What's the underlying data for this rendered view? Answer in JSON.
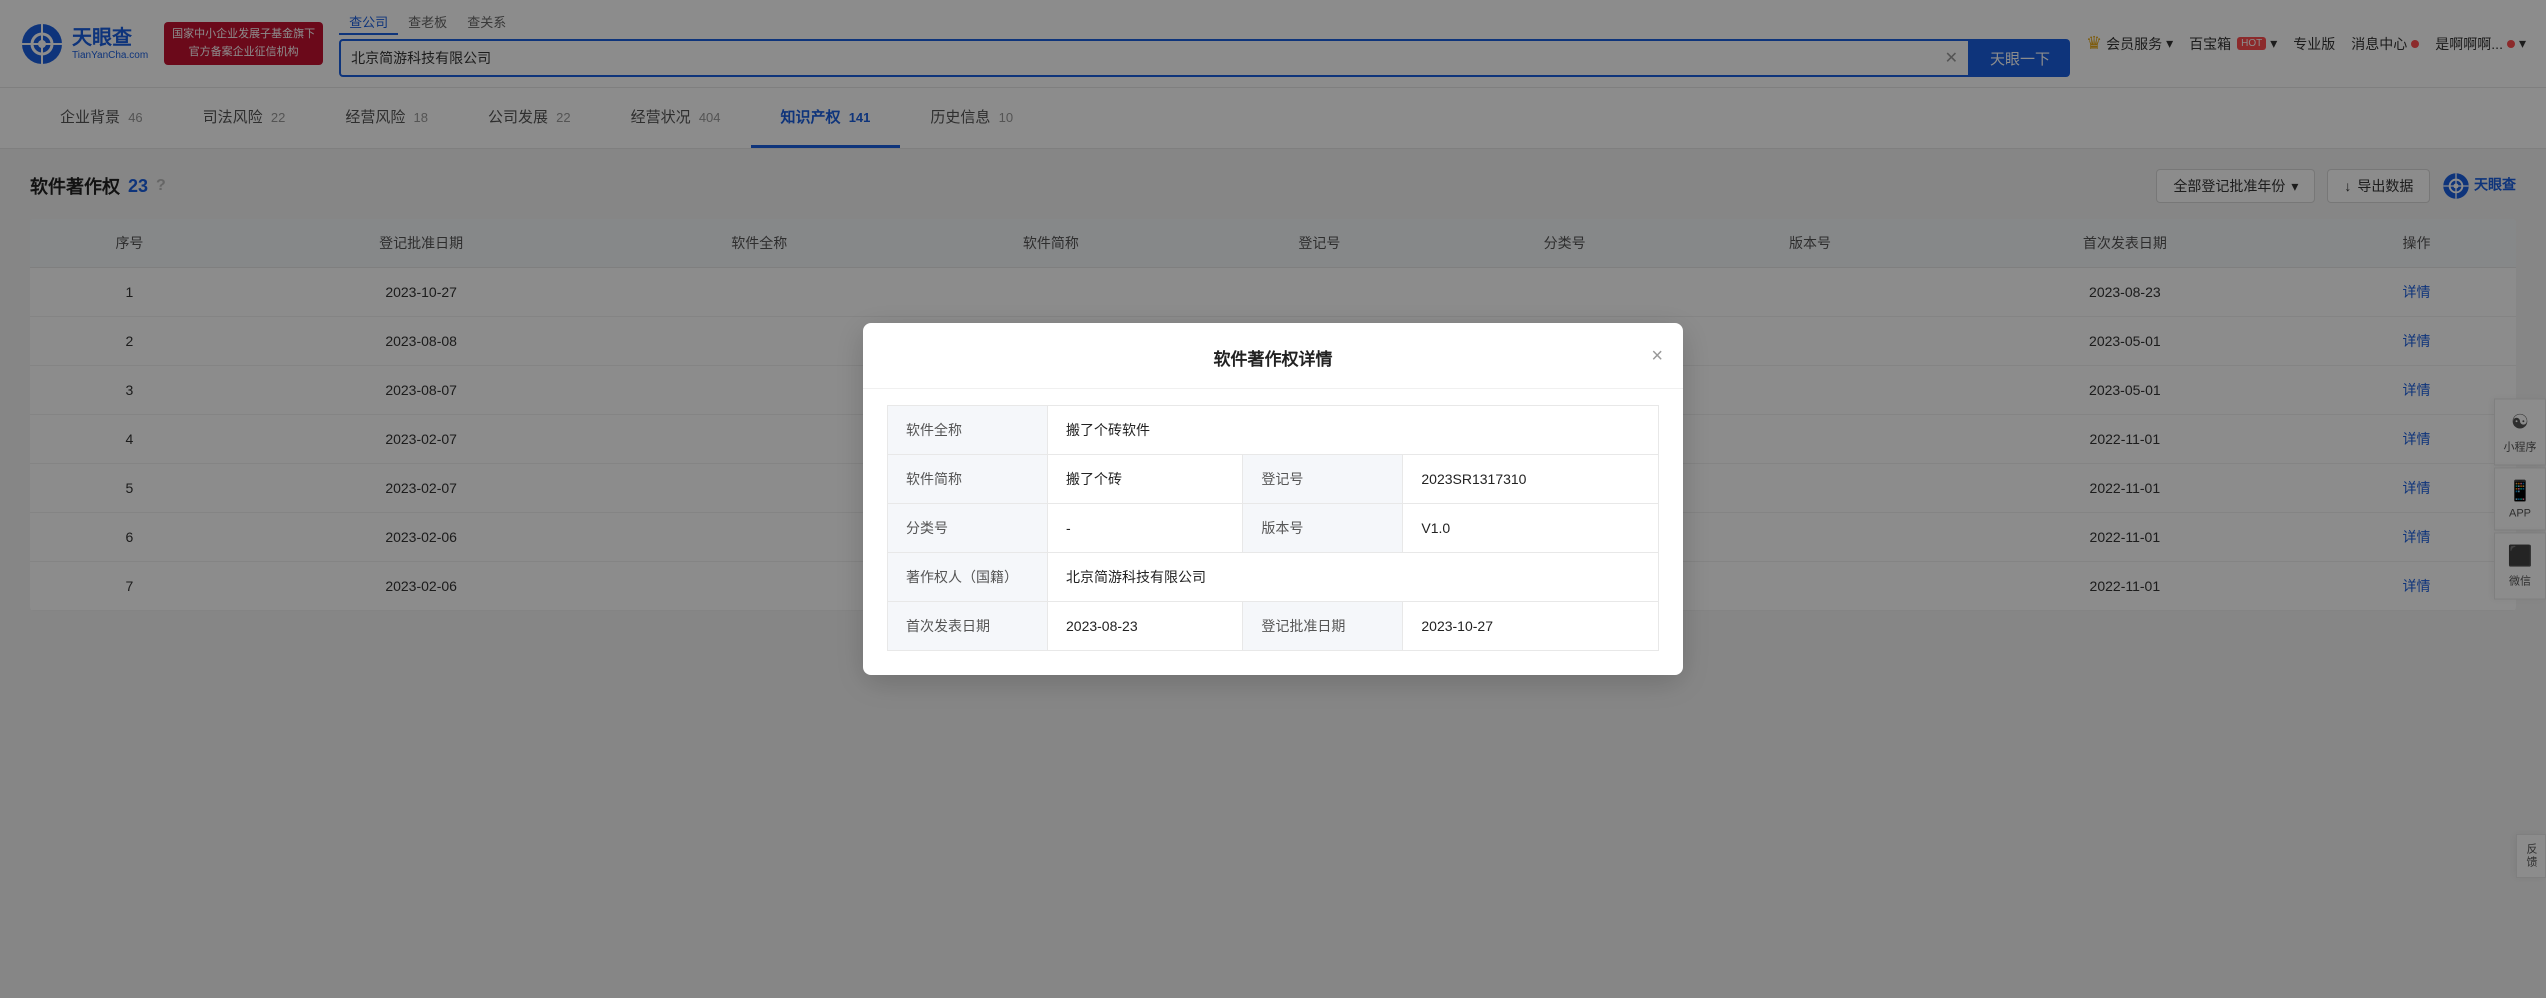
{
  "header": {
    "logo_cn": "天眼查",
    "logo_en": "TianYanCha.com",
    "promo_line1": "国家中小企业发展子基金旗下",
    "promo_line2": "官方备案企业征信机构",
    "search_tabs": [
      {
        "label": "查公司",
        "active": true
      },
      {
        "label": "查老板",
        "active": false
      },
      {
        "label": "查关系",
        "active": false
      }
    ],
    "search_value": "北京简游科技有限公司",
    "search_btn": "天眼一下",
    "nav_items": [
      {
        "label": "会员服务",
        "has_crown": true,
        "has_dropdown": true
      },
      {
        "label": "百宝箱",
        "has_hot": true,
        "has_dropdown": true
      },
      {
        "label": "专业版",
        "has_dropdown": false
      },
      {
        "label": "消息中心",
        "has_dot": true
      },
      {
        "label": "是啊啊啊...",
        "has_dot": true,
        "has_dropdown": true
      }
    ]
  },
  "sub_nav": {
    "items": [
      {
        "label": "企业背景",
        "count": "46",
        "active": false
      },
      {
        "label": "司法风险",
        "count": "22",
        "active": false
      },
      {
        "label": "经营风险",
        "count": "18",
        "active": false
      },
      {
        "label": "公司发展",
        "count": "22",
        "active": false
      },
      {
        "label": "经营状况",
        "count": "404",
        "active": false
      },
      {
        "label": "知识产权",
        "count": "141",
        "active": true
      },
      {
        "label": "历史信息",
        "count": "10",
        "active": false
      }
    ]
  },
  "section": {
    "title": "软件著作权",
    "count": "23",
    "filter_label": "全部登记批准年份",
    "export_label": "导出数据",
    "brand_label": "天眼查"
  },
  "table": {
    "headers": [
      "序号",
      "登记批准日期",
      "软件全称",
      "软件简称",
      "登记号",
      "分类号",
      "版本号",
      "首次发表日期",
      "操作"
    ],
    "rows": [
      {
        "id": 1,
        "reg_date": "2023-10-27",
        "full_name": "",
        "short_name": "",
        "reg_no": "",
        "cat_no": "",
        "version": "",
        "pub_date": "2023-08-23",
        "action": "详情"
      },
      {
        "id": 2,
        "reg_date": "2023-08-08",
        "full_name": "",
        "short_name": "",
        "reg_no": "",
        "cat_no": "",
        "version": "",
        "pub_date": "2023-05-01",
        "action": "详情"
      },
      {
        "id": 3,
        "reg_date": "2023-08-07",
        "full_name": "",
        "short_name": "",
        "reg_no": "",
        "cat_no": "",
        "version": "",
        "pub_date": "2023-05-01",
        "action": "详情"
      },
      {
        "id": 4,
        "reg_date": "2023-02-07",
        "full_name": "",
        "short_name": "",
        "reg_no": "",
        "cat_no": "",
        "version": "",
        "pub_date": "2022-11-01",
        "action": "详情"
      },
      {
        "id": 5,
        "reg_date": "2023-02-07",
        "full_name": "",
        "short_name": "",
        "reg_no": "",
        "cat_no": "",
        "version": "",
        "pub_date": "2022-11-01",
        "action": "详情"
      },
      {
        "id": 6,
        "reg_date": "2023-02-06",
        "full_name": "",
        "short_name": "",
        "reg_no": "",
        "cat_no": "",
        "version": "",
        "pub_date": "2022-11-01",
        "action": "详情"
      },
      {
        "id": 7,
        "reg_date": "2023-02-06",
        "full_name": "",
        "short_name": "",
        "reg_no": "",
        "cat_no": "",
        "version": "",
        "pub_date": "2022-11-01",
        "action": "详情"
      }
    ]
  },
  "modal": {
    "title": "软件著作权详情",
    "fields": [
      {
        "label": "软件全称",
        "value": "搬了个砖软件",
        "col_span": 3
      },
      {
        "label": "软件简称",
        "value": "搬了个砖",
        "label2": "登记号",
        "value2": "2023SR1317310"
      },
      {
        "label": "分类号",
        "value": "-",
        "label2": "版本号",
        "value2": "V1.0"
      },
      {
        "label": "著作权人（国籍）",
        "value": "北京简游科技有限公司",
        "col_span": 3
      },
      {
        "label": "首次发表日期",
        "value": "2023-08-23",
        "label2": "登记批准日期",
        "value2": "2023-10-27"
      }
    ],
    "close_label": "×"
  },
  "side_tools": [
    {
      "icon": "☯",
      "label": "小程序"
    },
    {
      "icon": "📱",
      "label": "APP"
    },
    {
      "icon": "⬛",
      "label": "微信"
    }
  ],
  "feedback": "反馈"
}
